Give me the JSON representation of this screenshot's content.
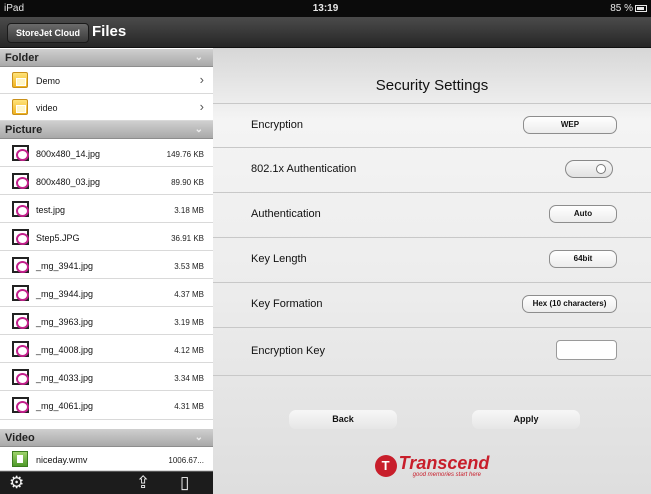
{
  "status_bar": {
    "device": "iPad",
    "time": "13:19",
    "battery": "85 %"
  },
  "sidebar": {
    "back_label": "StoreJet Cloud",
    "title": "Files",
    "sections": {
      "folder": {
        "label": "Folder",
        "items": [
          {
            "name": "Demo"
          },
          {
            "name": "video"
          }
        ]
      },
      "picture": {
        "label": "Picture",
        "items": [
          {
            "name": "800x480_14.jpg",
            "size": "149.76 KB"
          },
          {
            "name": "800x480_03.jpg",
            "size": "89.90 KB"
          },
          {
            "name": "test.jpg",
            "size": "3.18 MB"
          },
          {
            "name": "Step5.JPG",
            "size": "36.91 KB"
          },
          {
            "name": "_mg_3941.jpg",
            "size": "3.53 MB"
          },
          {
            "name": "_mg_3944.jpg",
            "size": "4.37 MB"
          },
          {
            "name": "_mg_3963.jpg",
            "size": "3.19 MB"
          },
          {
            "name": "_mg_4008.jpg",
            "size": "4.12 MB"
          },
          {
            "name": "_mg_4033.jpg",
            "size": "3.34 MB"
          },
          {
            "name": "_mg_4061.jpg",
            "size": "4.31 MB"
          }
        ]
      },
      "video": {
        "label": "Video",
        "items": [
          {
            "name": "niceday.wmv",
            "size": "1006.67..."
          }
        ]
      }
    },
    "toolbar_icons": [
      "gear-icon",
      "share-icon",
      "device-icon"
    ]
  },
  "main": {
    "title": "Security Settings",
    "settings": [
      {
        "label": "Encryption",
        "value": "WEP"
      },
      {
        "label": "802.1x Authentication",
        "toggle": "off"
      },
      {
        "label": "Authentication",
        "value": "Auto"
      },
      {
        "label": "Key Length",
        "value": "64bit"
      },
      {
        "label": "Key Formation",
        "value": "Hex (10 characters)"
      },
      {
        "label": "Encryption Key",
        "value": ""
      }
    ],
    "back_button": "Back",
    "apply_button": "Apply",
    "logo": {
      "name": "Transcend",
      "tagline": "good memories start here"
    }
  },
  "colors": {
    "brand": "#c81e2b",
    "picture_icon": "#c4208c",
    "folder_icon": "#f0b21f"
  }
}
